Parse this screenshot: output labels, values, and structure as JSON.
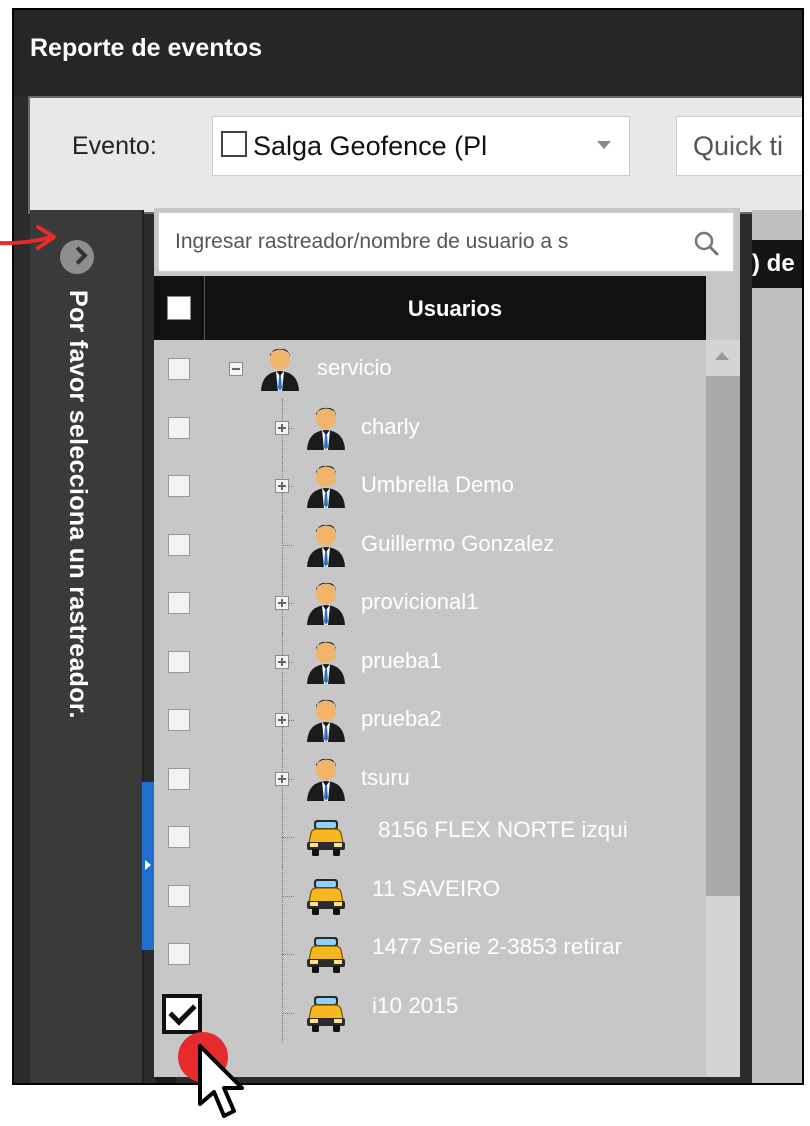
{
  "window": {
    "title": "Reporte de eventos"
  },
  "toolbar": {
    "event_label": "Evento:",
    "event_value": "Salga Geofence (Pl",
    "quick_text": "Quick ti"
  },
  "sidebar": {
    "message": "Por favor selecciona un rastreador."
  },
  "right_panel": {
    "tab_fragment": ") de"
  },
  "search": {
    "placeholder": "Ingresar rastreador/nombre de usuario a s"
  },
  "table": {
    "header": "Usuarios"
  },
  "tree": [
    {
      "name": "servicio",
      "type": "user",
      "level": 0,
      "toggle": "minus",
      "checked": false
    },
    {
      "name": "charly",
      "type": "user",
      "level": 1,
      "toggle": "plus",
      "checked": false
    },
    {
      "name": "Umbrella Demo",
      "type": "user",
      "level": 1,
      "toggle": "plus",
      "checked": false
    },
    {
      "name": "Guillermo Gonzalez",
      "type": "user",
      "level": 1,
      "toggle": "none",
      "checked": false
    },
    {
      "name": "provicional1",
      "type": "user",
      "level": 1,
      "toggle": "plus",
      "checked": false
    },
    {
      "name": "prueba1",
      "type": "user",
      "level": 1,
      "toggle": "plus",
      "checked": false
    },
    {
      "name": "prueba2",
      "type": "user",
      "level": 1,
      "toggle": "plus",
      "checked": false
    },
    {
      "name": "tsuru",
      "type": "user",
      "level": 1,
      "toggle": "plus",
      "checked": false
    },
    {
      "name": "8156 FLEX NORTE izqui",
      "type": "vehicle",
      "level": 1,
      "toggle": "none",
      "checked": false
    },
    {
      "name": "11 SAVEIRO",
      "type": "vehicle",
      "level": 1,
      "toggle": "none",
      "checked": false
    },
    {
      "name": "1477 Serie 2-3853 retirar",
      "type": "vehicle",
      "level": 1,
      "toggle": "none",
      "checked": false
    },
    {
      "name": "i10 2015",
      "type": "vehicle",
      "level": 1,
      "toggle": "none",
      "checked": true
    }
  ],
  "icons": {
    "user": "user-icon",
    "vehicle": "taxi-icon",
    "search": "search-icon",
    "expand": "chevron-right-icon"
  },
  "colors": {
    "title_bar": "#262626",
    "panel_bg": "#c7c7c7",
    "header_bg": "#111111",
    "annotation": "#e52b2b",
    "blue_tab": "#1f6fd1"
  }
}
